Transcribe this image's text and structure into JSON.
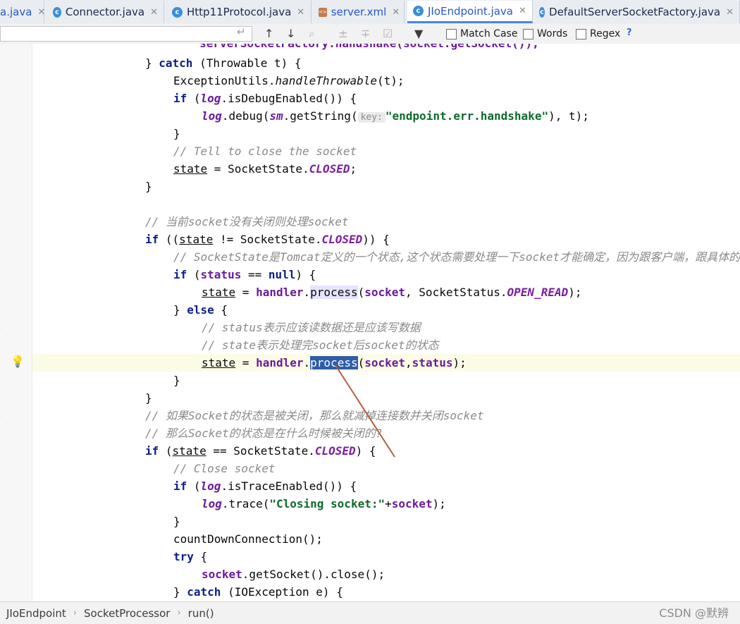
{
  "tabs": [
    {
      "label": "a.java",
      "icon": "none"
    },
    {
      "label": "Connector.java",
      "icon": "class-icon"
    },
    {
      "label": "Http11Protocol.java",
      "icon": "class-icon"
    },
    {
      "label": "server.xml",
      "icon": "xml-icon"
    },
    {
      "label": "JIoEndpoint.java",
      "icon": "class-icon",
      "active": true
    },
    {
      "label": "DefaultServerSocketFactory.java",
      "icon": "class-icon"
    }
  ],
  "search": {
    "match_case": "Match Case",
    "words": "Words",
    "regex": "Regex",
    "help": "?"
  },
  "code": {
    "l0": "        serverSocketFactory.handshake(socket.getSocket());",
    "l1_kw": "catch",
    "l1_rest": " (Throwable t) {",
    "l2_a": "ExceptionUtils.",
    "l2_b": "handleThrowable",
    "l2_c": "(t);",
    "l3_kw": "if",
    "l3_log": "log",
    "l3_rest": ".isDebugEnabled()) {",
    "l4_log": "log",
    "l4_a": ".debug(",
    "l4_sm": "sm",
    "l4_b": ".getString(",
    "l4_hint": "key:",
    "l4_str": "\"endpoint.err.handshake\"",
    "l4_c": "), t);",
    "l6": "// Tell to close the socket",
    "l7_state": "state",
    "l7_a": " = SocketState.",
    "l7_const": "CLOSED",
    "l9_cmt": "// 当前socket没有关闭则处理socket",
    "l10_kw": "if",
    "l10_state": "state",
    "l10_a": " != SocketState.",
    "l10_const": "CLOSED",
    "l10_b": ")) {",
    "l11_cmt": "// SocketState是Tomcat定义的一个状态,这个状态需要处理一下socket才能确定，因为跟客户端，跟具体的请求",
    "l12_kw": "if",
    "l12_status": "status",
    "l12_null": "null",
    "l13_state": "state",
    "l13_handler": "handler",
    "l13_process": "process",
    "l13_socket": "socket",
    "l13_b": ", SocketStatus.",
    "l13_const": "OPEN_READ",
    "l14_else": "else",
    "l15_cmt": "// status表示应该读数据还是应该写数据",
    "l16_cmt": "// state表示处理完socket后socket的状态",
    "l17_state": "state",
    "l17_handler": "handler",
    "l17_process": "process",
    "l17_socket": "socket",
    "l17_status": "status",
    "l20_cmt": "// 如果Socket的状态是被关闭，那么就减掉连接数并关闭socket",
    "l21_cmt": "// 那么Socket的状态是在什么时候被关闭的?",
    "l22_kw": "if",
    "l22_state": "state",
    "l22_a": " == SocketState.",
    "l22_const": "CLOSED",
    "l23_cmt": "// Close socket",
    "l24_kw": "if",
    "l24_log": "log",
    "l24_rest": ".isTraceEnabled()) {",
    "l25_log": "log",
    "l25_a": ".trace(",
    "l25_str": "\"Closing socket:\"",
    "l25_socket": "socket",
    "l27": "countDownConnection();",
    "l28_kw": "try",
    "l29_socket": "socket",
    "l29_rest": ".getSocket().close();",
    "l30_kw": "catch",
    "l30_rest": " (IOException e) {"
  },
  "breadcrumb": [
    "JIoEndpoint",
    "SocketProcessor",
    "run()"
  ],
  "watermark": "CSDN @默辨",
  "colors": {
    "keyword": "#0b1f8a",
    "field": "#6a1b9a",
    "string": "#0d6b2b",
    "comment": "#8a8a8a",
    "selection": "#2f5ea8"
  }
}
